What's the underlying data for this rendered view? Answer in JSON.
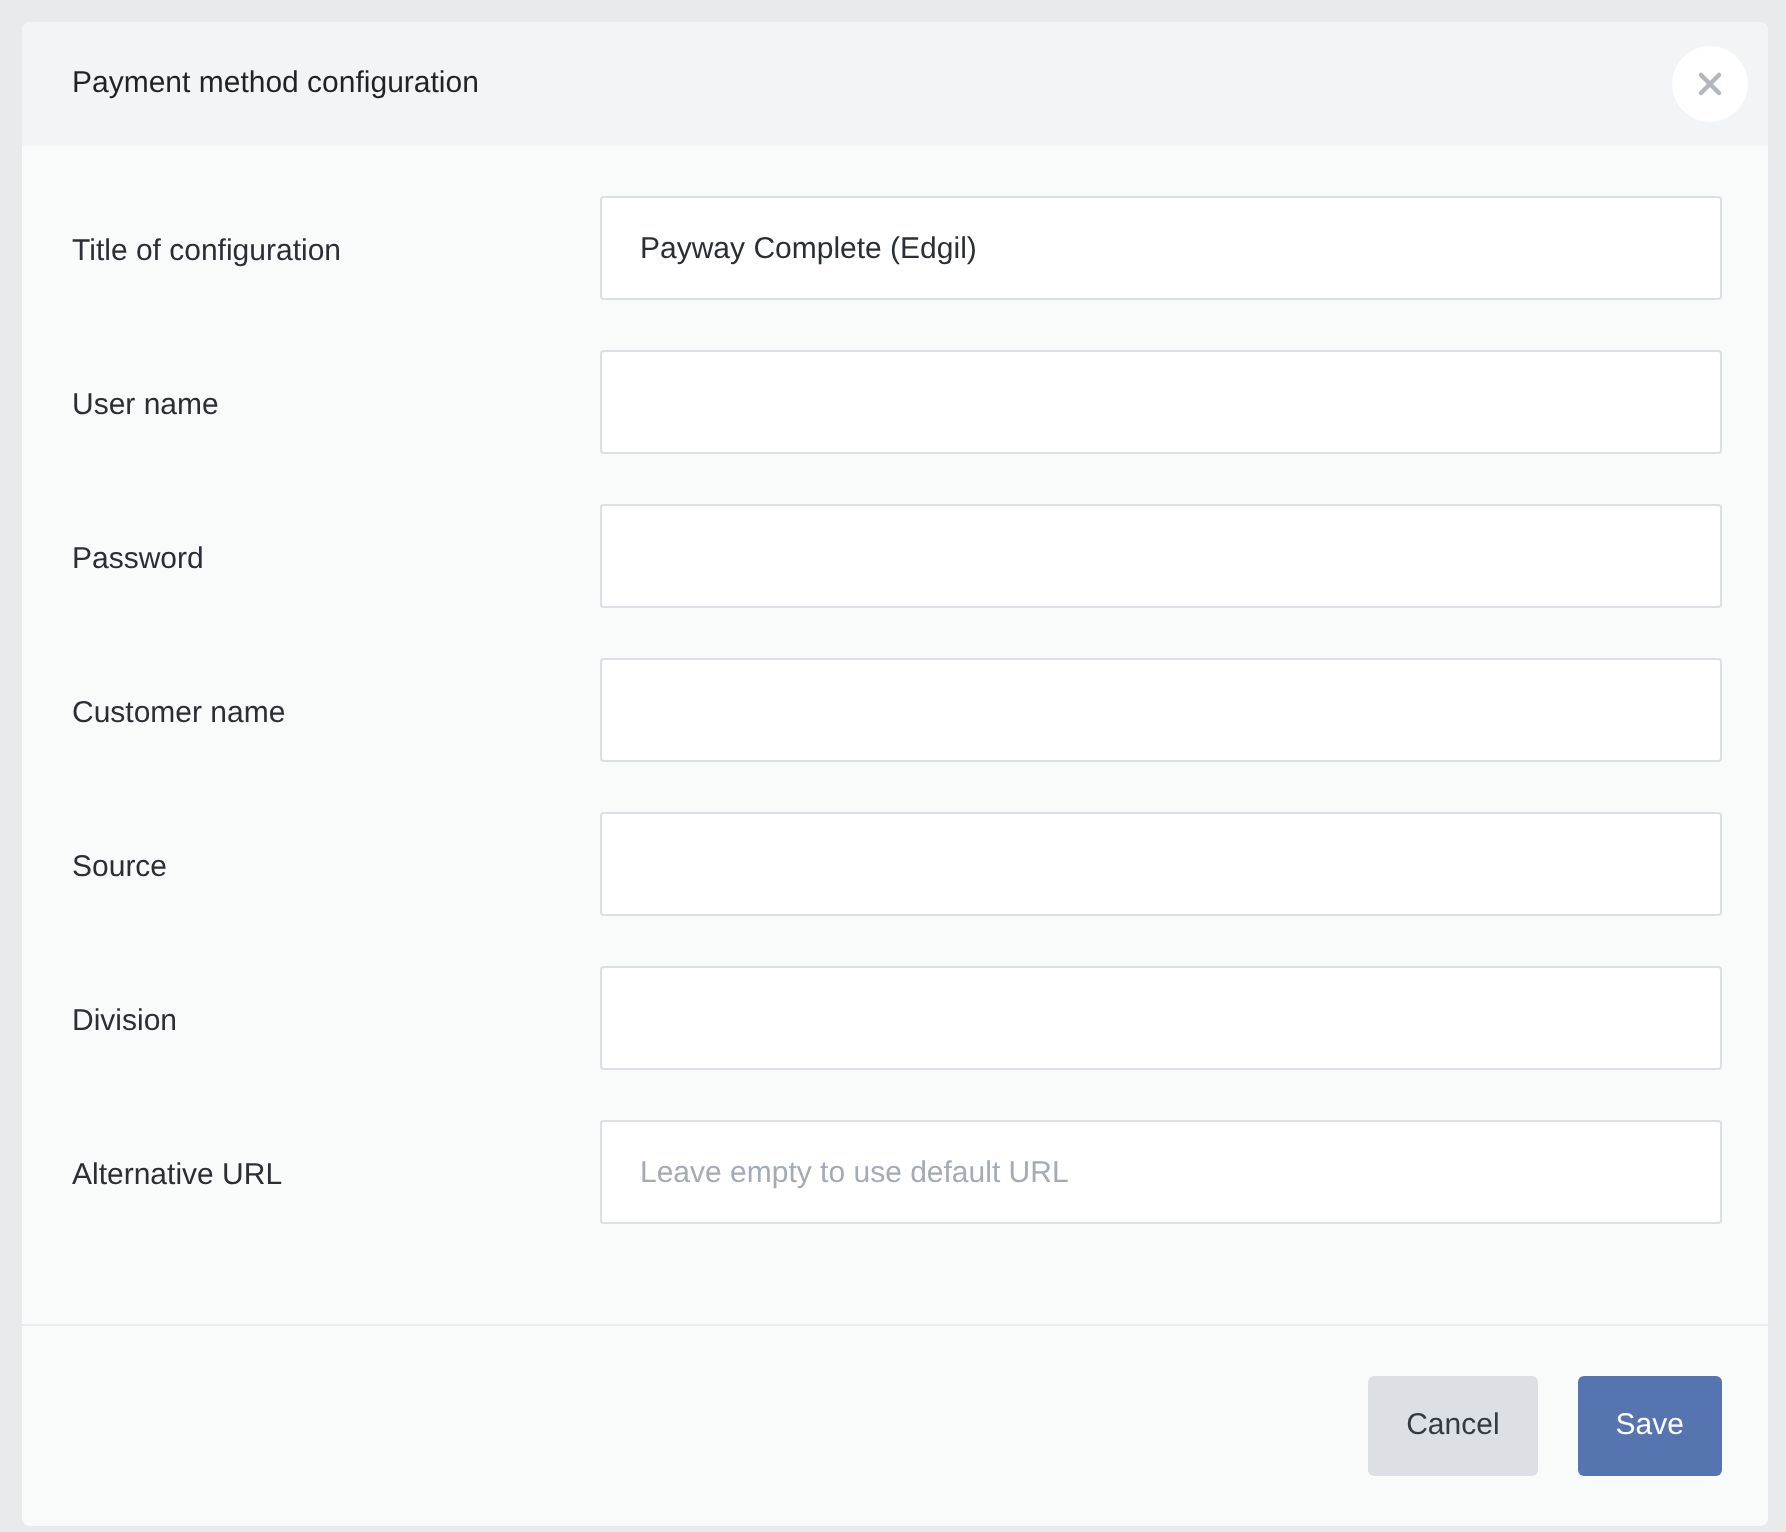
{
  "dialog": {
    "title": "Payment method configuration"
  },
  "fields": [
    {
      "label": "Title of configuration",
      "value": "Payway Complete (Edgil)"
    },
    {
      "label": "User name"
    },
    {
      "label": "Password"
    },
    {
      "label": "Customer name"
    },
    {
      "label": "Source"
    },
    {
      "label": "Division"
    },
    {
      "label": "Alternative URL",
      "placeholder": "Leave empty to use default URL"
    }
  ],
  "buttons": [
    {
      "label": "Cancel",
      "kind": "secondary"
    },
    {
      "label": "Save",
      "kind": "primary"
    }
  ]
}
